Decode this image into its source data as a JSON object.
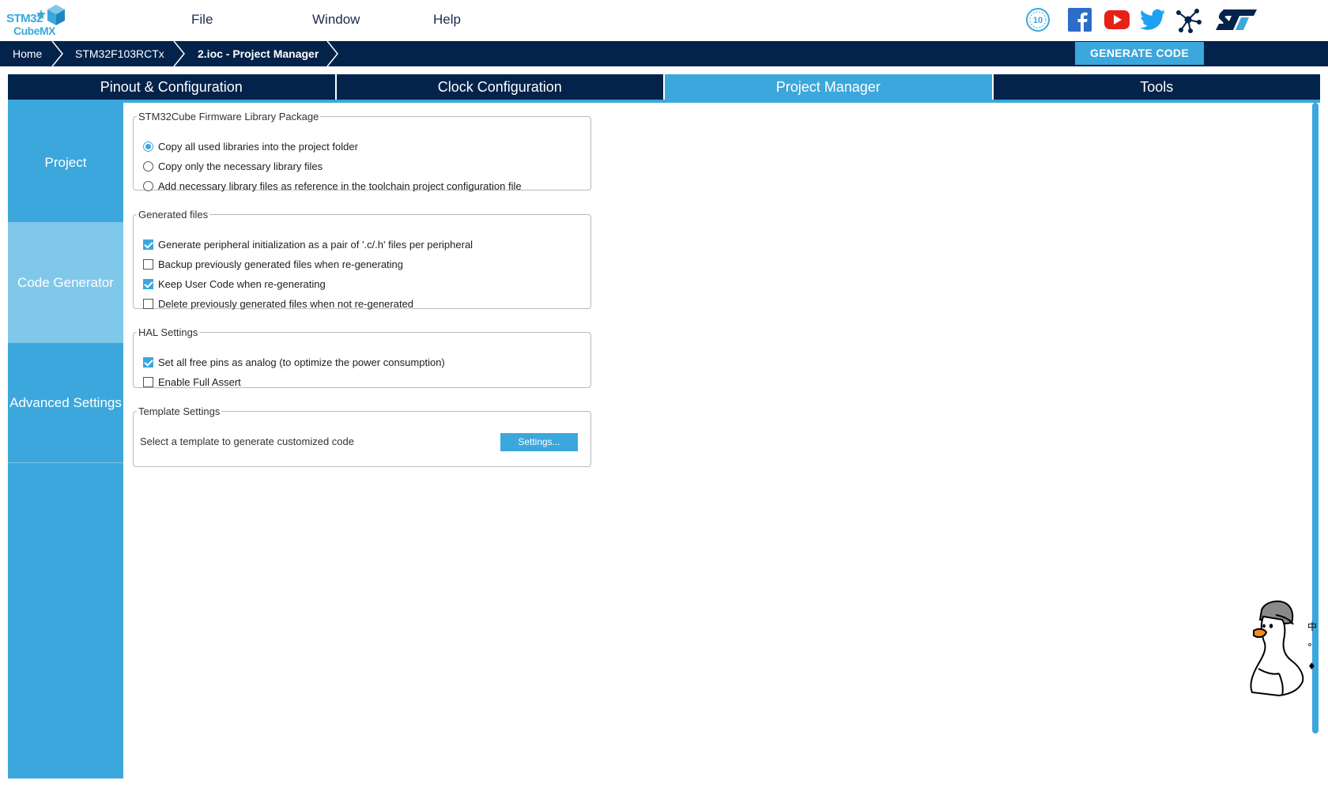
{
  "app": {
    "logo_line1": "STM32",
    "logo_line2": "CubeMX"
  },
  "menu": {
    "file": "File",
    "window": "Window",
    "help": "Help"
  },
  "social_icons": [
    "anniversary-badge-icon",
    "facebook-icon",
    "youtube-icon",
    "twitter-icon",
    "network-icon",
    "st-logo-icon"
  ],
  "breadcrumb": {
    "home": "Home",
    "device": "STM32F103RCTx",
    "project": "2.ioc - Project Manager"
  },
  "generate_code_label": "GENERATE CODE",
  "tabs": [
    {
      "label": "Pinout & Configuration",
      "active": false
    },
    {
      "label": "Clock Configuration",
      "active": false
    },
    {
      "label": "Project Manager",
      "active": true
    },
    {
      "label": "Tools",
      "active": false
    }
  ],
  "sidenav": [
    {
      "label": "Project",
      "active": false
    },
    {
      "label": "Code Generator",
      "active": true
    },
    {
      "label": "Advanced Settings",
      "active": false
    }
  ],
  "firmware_group": {
    "legend": "STM32Cube Firmware Library Package",
    "options": [
      {
        "label": "Copy all used libraries into the project folder",
        "selected": true
      },
      {
        "label": "Copy only the necessary library files",
        "selected": false
      },
      {
        "label": "Add necessary library files as reference in the toolchain project configuration file",
        "selected": false
      }
    ]
  },
  "generated_files_group": {
    "legend": "Generated files",
    "options": [
      {
        "label": "Generate peripheral initialization as a pair of '.c/.h' files per peripheral",
        "checked": true
      },
      {
        "label": "Backup previously generated files when re-generating",
        "checked": false
      },
      {
        "label": "Keep User Code when re-generating",
        "checked": true
      },
      {
        "label": "Delete previously generated files when not re-generated",
        "checked": false
      }
    ]
  },
  "hal_group": {
    "legend": "HAL Settings",
    "options": [
      {
        "label": "Set all free pins as analog (to optimize the power consumption)",
        "checked": true
      },
      {
        "label": "Enable Full Assert",
        "checked": false
      }
    ]
  },
  "template_group": {
    "legend": "Template Settings",
    "description": "Select a template to generate customized code",
    "button_label": "Settings..."
  },
  "side_glyphs": [
    "中",
    "°",
    "♦"
  ],
  "colors": {
    "navy": "#03234b",
    "accent": "#3ba7dc",
    "active_side": "#7fc8ea"
  }
}
